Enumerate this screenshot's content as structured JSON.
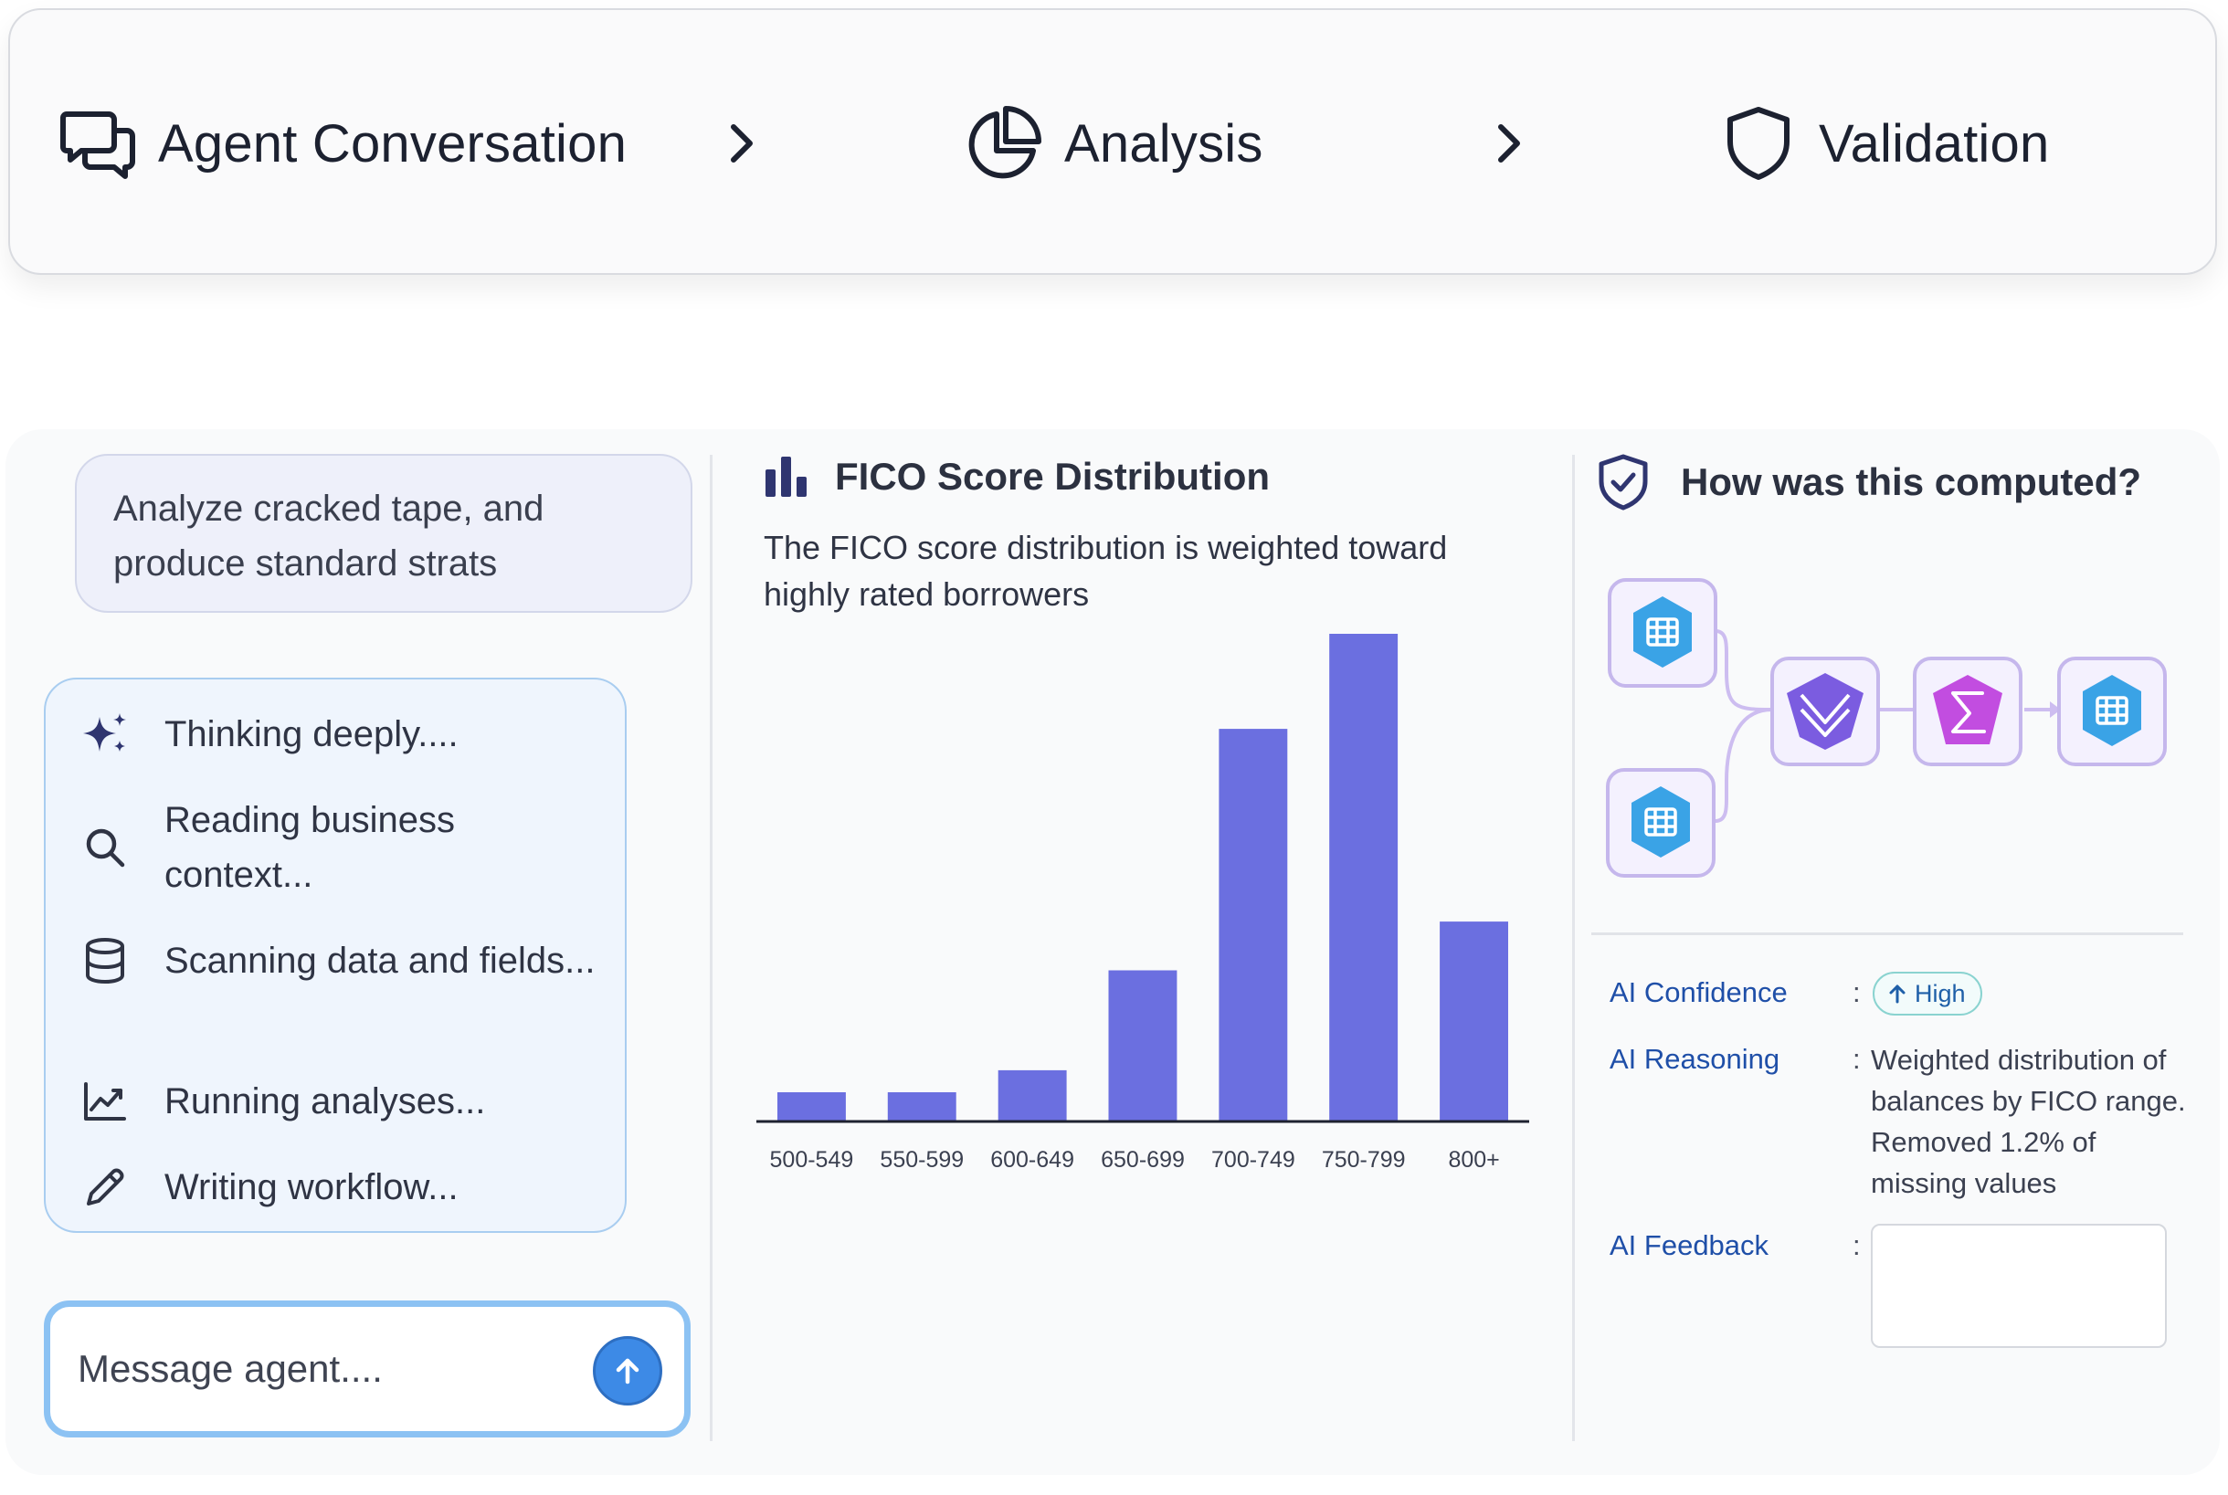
{
  "stepper": {
    "steps": [
      {
        "label": "Agent Conversation",
        "icon": "chat-bubbles-icon"
      },
      {
        "label": "Analysis",
        "icon": "pie-chart-icon"
      },
      {
        "label": "Validation",
        "icon": "shield-icon"
      }
    ]
  },
  "conversation": {
    "prompt": "Analyze cracked tape, and produce standard strats",
    "thinking_steps": [
      {
        "text": "Thinking deeply....",
        "icon": "sparkles-icon"
      },
      {
        "text": "Reading business context...",
        "icon": "search-icon"
      },
      {
        "text": "Scanning data and fields...",
        "icon": "database-icon"
      },
      {
        "text": "Running analyses...",
        "icon": "trend-chart-icon"
      },
      {
        "text": "Writing workflow...",
        "icon": "pencil-icon"
      }
    ],
    "input_placeholder": "Message agent....",
    "send_icon": "arrow-up-icon"
  },
  "analysis": {
    "header_icon": "bar-chart-icon",
    "title": "FICO Score Distribution",
    "subtitle": "The FICO score distribution is weighted toward highly rated borrowers",
    "bar_color": "#6b6fe0"
  },
  "chart_data": {
    "type": "bar",
    "title": "FICO Score Distribution",
    "categories": [
      "500-549",
      "550-599",
      "600-649",
      "650-699",
      "700-749",
      "750-799",
      "800+"
    ],
    "values": [
      6,
      6,
      10.5,
      31,
      80.5,
      100,
      41
    ],
    "ylim": [
      0,
      100
    ],
    "grid": false,
    "xlabel": "",
    "ylabel": ""
  },
  "validation": {
    "header_icon": "shield-check-icon",
    "title": "How was this computed?",
    "flow_nodes": [
      {
        "icon": "table-icon",
        "color": "#3aa3e6"
      },
      {
        "icon": "table-icon",
        "color": "#3aa3e6"
      },
      {
        "icon": "merge-icon",
        "color": "#7b5ce0"
      },
      {
        "icon": "sigma-icon",
        "color": "#c24de0"
      },
      {
        "icon": "table-icon",
        "color": "#3aa3e6"
      }
    ],
    "confidence_label": "AI Confidence",
    "confidence_value": "High",
    "reasoning_label": "AI Reasoning",
    "reasoning_value": "Weighted distribution of balances by FICO range. Removed 1.2% of missing values",
    "feedback_label": "AI Feedback",
    "separator": ":"
  }
}
